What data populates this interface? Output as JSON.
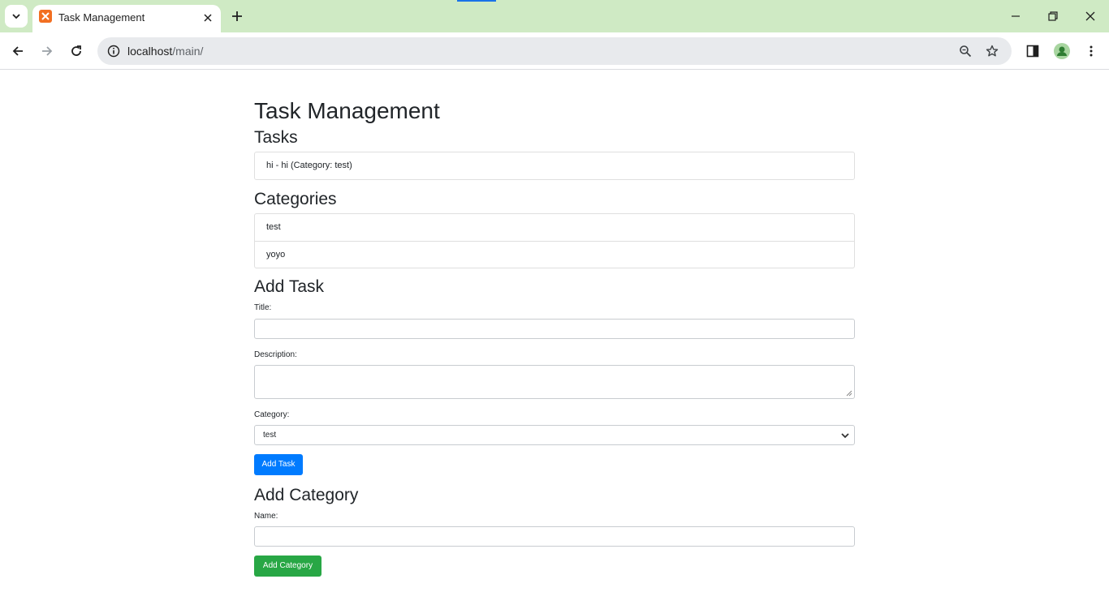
{
  "browser": {
    "tab_title": "Task Management",
    "url_host": "localhost",
    "url_path": "/main/"
  },
  "page": {
    "title": "Task Management",
    "tasks_heading": "Tasks",
    "tasks": [
      {
        "text": "hi - hi (Category: test)"
      }
    ],
    "categories_heading": "Categories",
    "categories": [
      {
        "name": "test"
      },
      {
        "name": "yoyo"
      }
    ],
    "add_task": {
      "heading": "Add Task",
      "title_label": "Title:",
      "title_value": "",
      "description_label": "Description:",
      "description_value": "",
      "category_label": "Category:",
      "category_selected": "test",
      "submit_label": "Add Task"
    },
    "add_category": {
      "heading": "Add Category",
      "name_label": "Name:",
      "name_value": "",
      "submit_label": "Add Category"
    }
  },
  "colors": {
    "tabstrip": "#cfeac4",
    "primary": "#007bff",
    "success": "#28a745"
  }
}
